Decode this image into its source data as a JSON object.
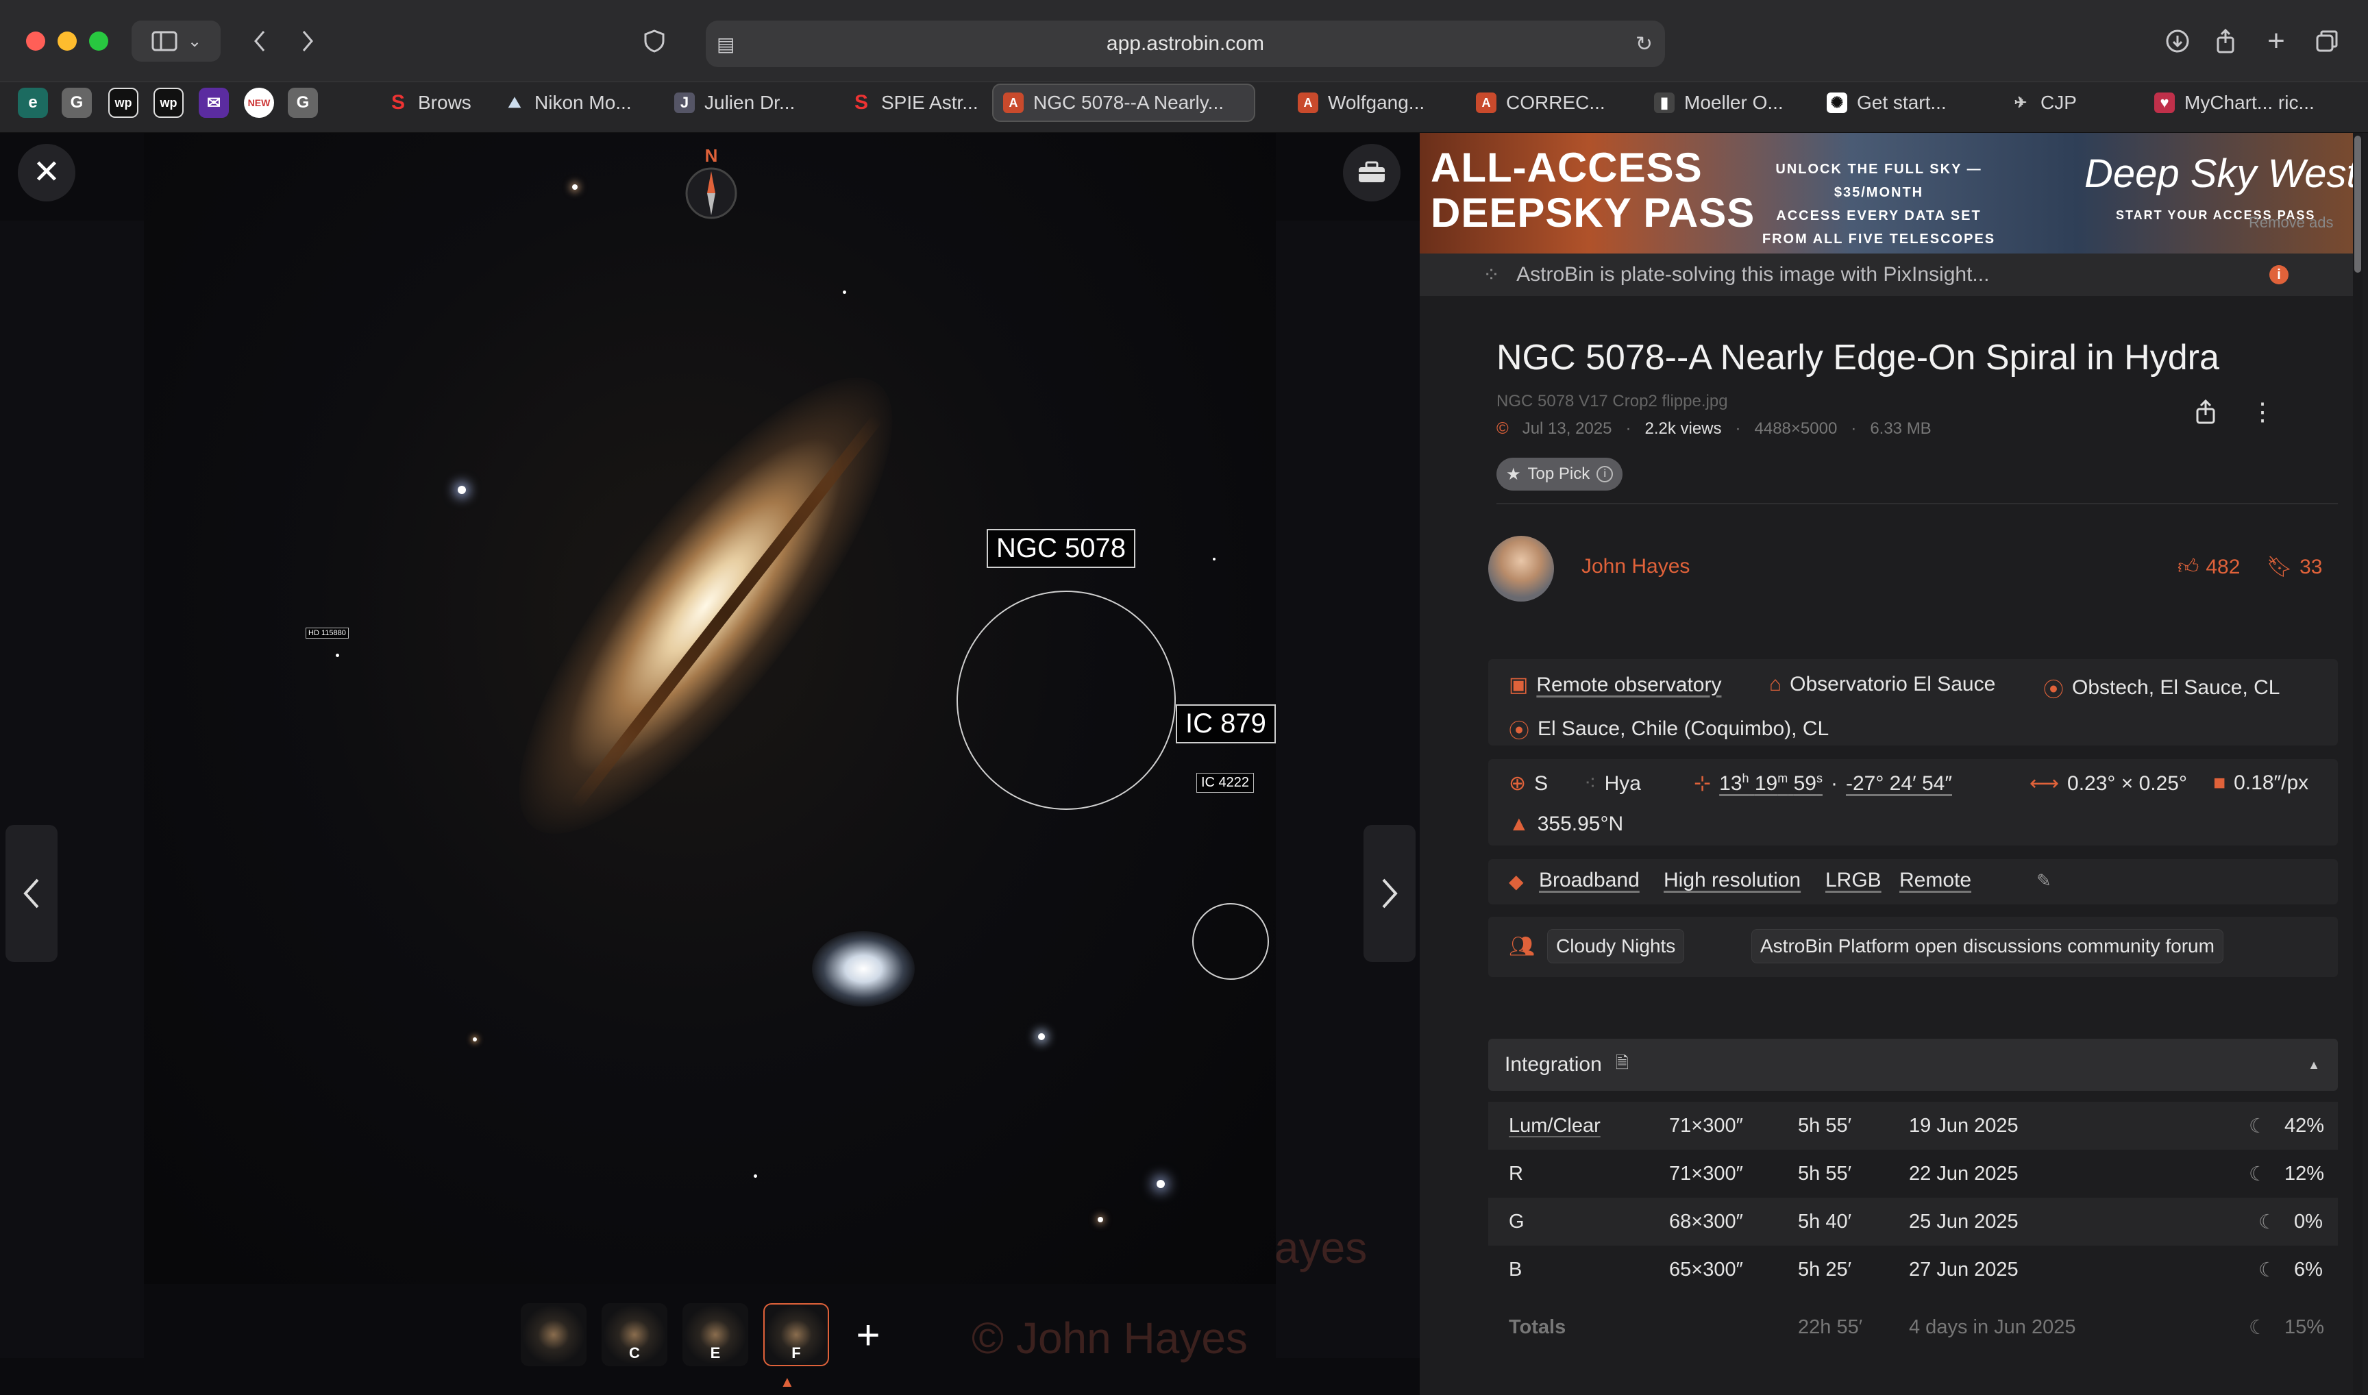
{
  "browser": {
    "url": "app.astrobin.com",
    "tabs": [
      {
        "label": "Brows"
      },
      {
        "label": "Nikon Mo..."
      },
      {
        "label": "Julien Dr..."
      },
      {
        "label": "SPIE Astr..."
      },
      {
        "label": "NGC 5078--A Nearly...",
        "active": true
      },
      {
        "label": "Wolfgang..."
      },
      {
        "label": "CORREC..."
      },
      {
        "label": "Moeller O..."
      },
      {
        "label": "Get start..."
      },
      {
        "label": "CJP"
      },
      {
        "label": "MyChart... ric..."
      }
    ],
    "pinned": [
      "e",
      "G",
      "wp",
      "wp",
      "mail",
      "news",
      "G"
    ]
  },
  "viewer": {
    "compass": "N",
    "annotations": {
      "main": "NGC 5078",
      "second": "IC 879",
      "small": "IC 4222",
      "tiny": "HD 115880"
    },
    "thumbnails": [
      {
        "label": ""
      },
      {
        "label": "C"
      },
      {
        "label": "E"
      },
      {
        "label": "F",
        "active": true
      }
    ],
    "watermark": "© John Hayes",
    "watermark_partial": "ayes"
  },
  "ad": {
    "title_line1": "ALL-ACCESS",
    "title_line2": "DEEPSKY PASS",
    "mid_line1": "UNLOCK THE FULL SKY — $35/MONTH",
    "mid_line2": "ACCESS EVERY DATA SET",
    "mid_line3": "FROM ALL FIVE TELESCOPES",
    "brand": "Deep Sky West",
    "cta": "START YOUR ACCESS PASS",
    "remove": "Remove ads"
  },
  "platesolve": {
    "text": "AstroBin is plate-solving this image with PixInsight..."
  },
  "image": {
    "title": "NGC 5078--A Nearly Edge-On Spiral in Hydra",
    "filename": "NGC 5078 V17 Crop2 flippe.jpg",
    "date": "Jul 13, 2025",
    "views": "2.2k views",
    "resolution": "4488×5000",
    "size": "6.33 MB",
    "badge": "Top Pick"
  },
  "author": {
    "name": "John Hayes",
    "likes": "482",
    "bookmarks": "33"
  },
  "location": {
    "type": "Remote observatory",
    "observatory": "Observatorio El Sauce",
    "site": "Obstech, El Sauce, CL",
    "place": "El Sauce, Chile (Coquimbo), CL"
  },
  "astrometry": {
    "hemisphere": "S",
    "constellation": "Hya",
    "ra": "13h 19m 59s",
    "ra_h": "13",
    "ra_m": "19",
    "ra_s": "59",
    "dec": "-27° 24′ 54″",
    "fov": "0.23° × 0.25°",
    "scale": "0.18″/px",
    "orientation": "355.95°N"
  },
  "tags": [
    "Broadband",
    "High resolution",
    "LRGB",
    "Remote"
  ],
  "groups": [
    "Cloudy Nights",
    "AstroBin Platform open discussions community forum"
  ],
  "integration": {
    "header": "Integration",
    "rows": [
      {
        "filter": "Lum/Clear",
        "frames": "71×300″",
        "time": "5h 55′",
        "date": "19 Jun 2025",
        "moon": "42%"
      },
      {
        "filter": "R",
        "frames": "71×300″",
        "time": "5h 55′",
        "date": "22 Jun 2025",
        "moon": "12%"
      },
      {
        "filter": "G",
        "frames": "68×300″",
        "time": "5h 40′",
        "date": "25 Jun 2025",
        "moon": "0%"
      },
      {
        "filter": "B",
        "frames": "65×300″",
        "time": "5h 25′",
        "date": "27 Jun 2025",
        "moon": "6%"
      }
    ],
    "totals": {
      "label": "Totals",
      "time": "22h 55′",
      "date": "4 days in Jun 2025",
      "moon": "15%"
    }
  },
  "colors": {
    "accent": "#e0623a",
    "panel_bg": "#1d1d1f",
    "viewer_bg": "#0b0b0e"
  }
}
